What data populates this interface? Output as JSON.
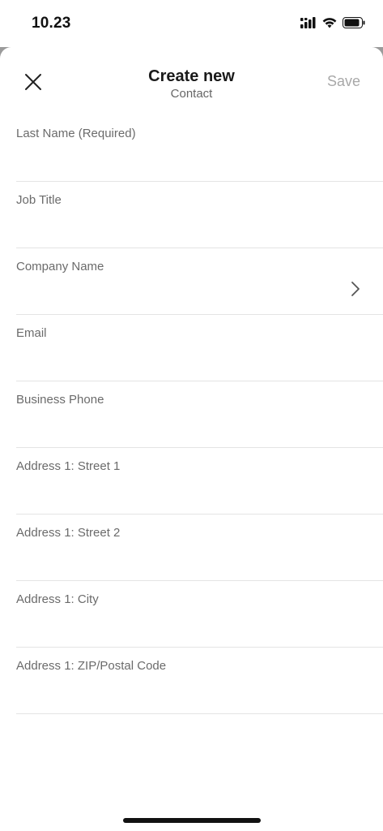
{
  "status_bar": {
    "time": "10.23"
  },
  "header": {
    "title": "Create new",
    "subtitle": "Contact",
    "save_label": "Save",
    "close_icon": "close-icon"
  },
  "fields": [
    {
      "label": "Last Name (Required)",
      "value": ""
    },
    {
      "label": "Job Title",
      "value": ""
    },
    {
      "label": "Company Name",
      "value": "",
      "has_chevron": true
    },
    {
      "label": "Email",
      "value": ""
    },
    {
      "label": "Business Phone",
      "value": ""
    },
    {
      "label": "Address 1: Street 1",
      "value": ""
    },
    {
      "label": "Address 1: Street 2",
      "value": ""
    },
    {
      "label": "Address 1: City",
      "value": ""
    },
    {
      "label": "Address 1: ZIP/Postal Code",
      "value": ""
    }
  ],
  "colors": {
    "save_disabled": "#a8a8a8",
    "label": "#6b6b6b",
    "divider": "#e4e4e4"
  }
}
